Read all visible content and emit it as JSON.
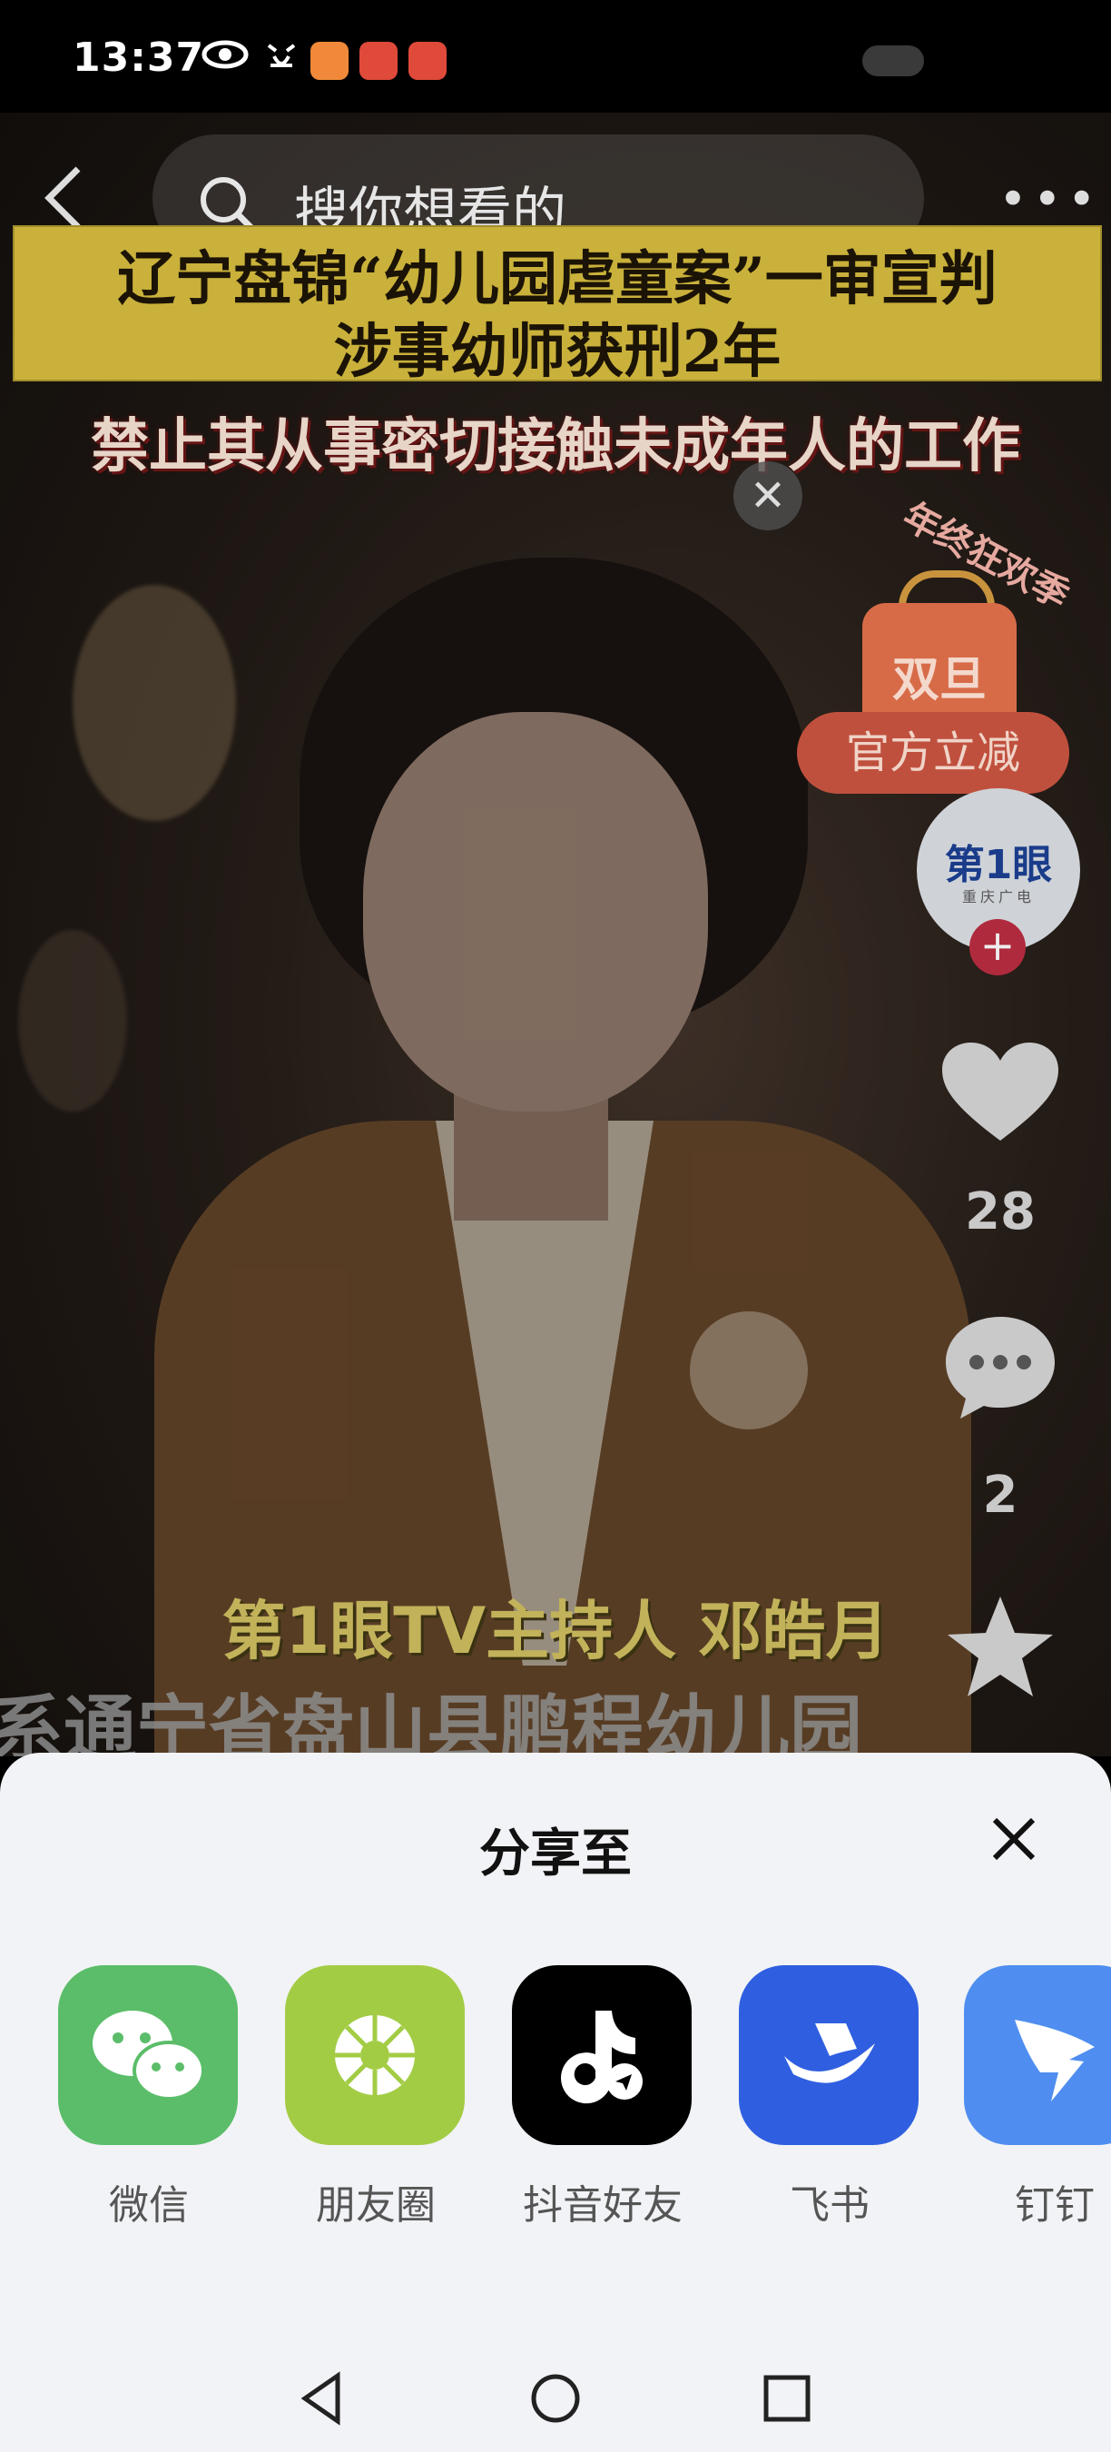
{
  "status_bar": {
    "time": "13:37",
    "icons": [
      "eye-icon",
      "alarm-icon",
      "app-badge-icon",
      "app-badge-icon",
      "app-badge-icon"
    ]
  },
  "video": {
    "search_placeholder": "搜你想看的",
    "headline_line1": "辽宁盘锦“幼儿园虐童案”一审宣判",
    "headline_line2": "涉事幼师获刑2年",
    "subheadline": "禁止其从事密切接触未成年人的工作",
    "promo_tag": "年终狂欢季",
    "promo_bag_text": "双旦",
    "promo_button": "官方立减",
    "account_logo_text": "第1眼",
    "account_logo_subtext": "重庆广电",
    "like_count": "28",
    "comment_count": "2",
    "caption": "第1眼TV主持人 邓皓月",
    "ticker_text": "系通宁省盘山县鹏程幼儿园"
  },
  "share_sheet": {
    "title": "分享至",
    "targets": [
      {
        "label": "微信",
        "icon": "wechat-icon",
        "color": "#5bbd69"
      },
      {
        "label": "朋友圈",
        "icon": "moments-icon",
        "color": "#a3cc45"
      },
      {
        "label": "抖音好友",
        "icon": "douyin-icon",
        "color": "#000000"
      },
      {
        "label": "飞书",
        "icon": "feishu-icon",
        "color": "#2f5fe0"
      },
      {
        "label": "钉钉",
        "icon": "dingtalk-icon",
        "color": "#4f8ef0"
      }
    ]
  },
  "nav_bar": {
    "buttons": [
      "back-triangle-icon",
      "home-circle-icon",
      "recents-square-icon"
    ]
  }
}
